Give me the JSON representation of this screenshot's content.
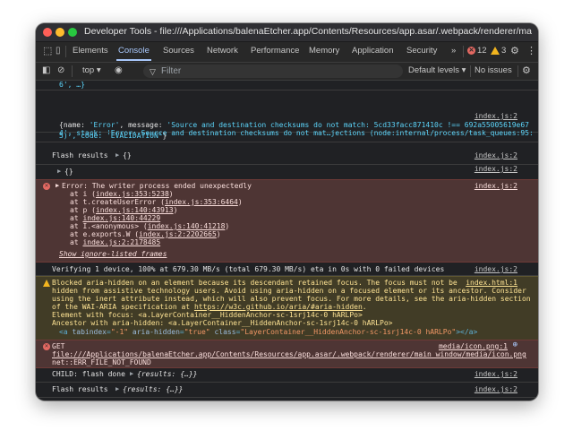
{
  "window": {
    "title": "Developer Tools - file:///Applications/balenaEtcher.app/Contents/Resources/app.asar/.webpack/renderer/main_w..."
  },
  "tabs": [
    "Elements",
    "Console",
    "Sources",
    "Network",
    "Performance",
    "Memory",
    "Application",
    "Security"
  ],
  "more_tabs": "»",
  "counts": {
    "errors": "12",
    "warnings": "3"
  },
  "toolbar": {
    "context": "top ▾",
    "filter_placeholder": "Filter",
    "levels": "Default levels ▾",
    "issues": "No issues"
  },
  "console": {
    "partial_line": "6', …}",
    "msg1": {
      "source": "index.js:2",
      "line1_prefix": "{name: ",
      "name_val": "'Error'",
      "line1_mid": ", message: ",
      "message_val": "'Source and destination checksums do not match: 5cd33facc871410c !== 692a55005619e67",
      "line2": "4', stack: 'Error: Source and destination checksums do not mat…jections (node:internal/process/task_queues:95:",
      "line3a": "5)', code: ",
      "code_val": "'EVALIDATION'",
      "line3b": "}"
    },
    "msg2": {
      "label": "Flash results",
      "obj": "{}",
      "source": "index.js:2"
    },
    "msg3": {
      "obj": "{}",
      "source": "index.js:2"
    },
    "error": {
      "source": "index.js:2",
      "head": "Error: The writer process ended unexpectedly",
      "stack": [
        {
          "pre": "at i (",
          "link": "index.js:353:5238",
          "post": ")"
        },
        {
          "pre": "at t.createUserError (",
          "link": "index.js:353:6464",
          "post": ")"
        },
        {
          "pre": "at p (",
          "link": "index.js:140:43913",
          "post": ")"
        },
        {
          "pre": "at ",
          "link": "index.js:140:44229",
          "post": ""
        },
        {
          "pre": "at I.<anonymous> (",
          "link": "index.js:140:41218",
          "post": ")"
        },
        {
          "pre": "at e.exports.W (",
          "link": "index.js:2:2202665",
          "post": ")"
        },
        {
          "pre": "at ",
          "link": "index.js:2:2178485",
          "post": ""
        }
      ],
      "ignore_list": "Show ignore-listed frames"
    },
    "verify": {
      "text": "Verifying 1 device, 100% at 679.30 MB/s (total 679.30 MB/s) eta in 0s with 0 failed devices",
      "source": "index.js:2"
    },
    "warning": {
      "source": "index.html:1",
      "lines": [
        "Blocked aria-hidden on an element because its descendant retained focus. The focus must not be",
        "hidden from assistive technology users. Avoid using aria-hidden on a focused element or its ancestor. Consider",
        "using the inert attribute instead, which will also prevent focus. For more details, see the aria-hidden section",
        "of the WAI-ARIA specification at "
      ],
      "spec_url": "https://w3c.github.io/aria/#aria-hidden",
      "spec_post": ".",
      "focus_line": "Element with focus: <a.LayerContainer__HiddenAnchor-sc-1srj14c-0 hARLPo>",
      "ancestor_line": "Ancestor with aria-hidden: <a.LayerContainer__HiddenAnchor-sc-1srj14c-0 hARLPo>",
      "node": {
        "open": "<a ",
        "a1n": "tabindex",
        "a1v": "\"-1\"",
        "a2n": "aria-hidden",
        "a2v": "\"true\"",
        "a3n": "class",
        "a3v": "\"LayerContainer__HiddenAnchor-sc-1srj14c-0 hARLPo\"",
        "close": "></a>"
      }
    },
    "get_error": {
      "method": "GET",
      "source": "media/icon.png:1",
      "url": "file:///Applications/balenaEtcher.app/Contents/Resources/app.asar/.webpack/renderer/main_window/media/icon.png",
      "status": "net::ERR_FILE_NOT_FOUND"
    },
    "child": {
      "label": "CHILD: flash done",
      "obj_key": "results",
      "obj_val": "{…}",
      "source": "index.js:2"
    },
    "flash2": {
      "label": "Flash results",
      "obj_key": "results",
      "obj_val": "{…}",
      "source": "index.js:2"
    },
    "prompt": "›"
  }
}
